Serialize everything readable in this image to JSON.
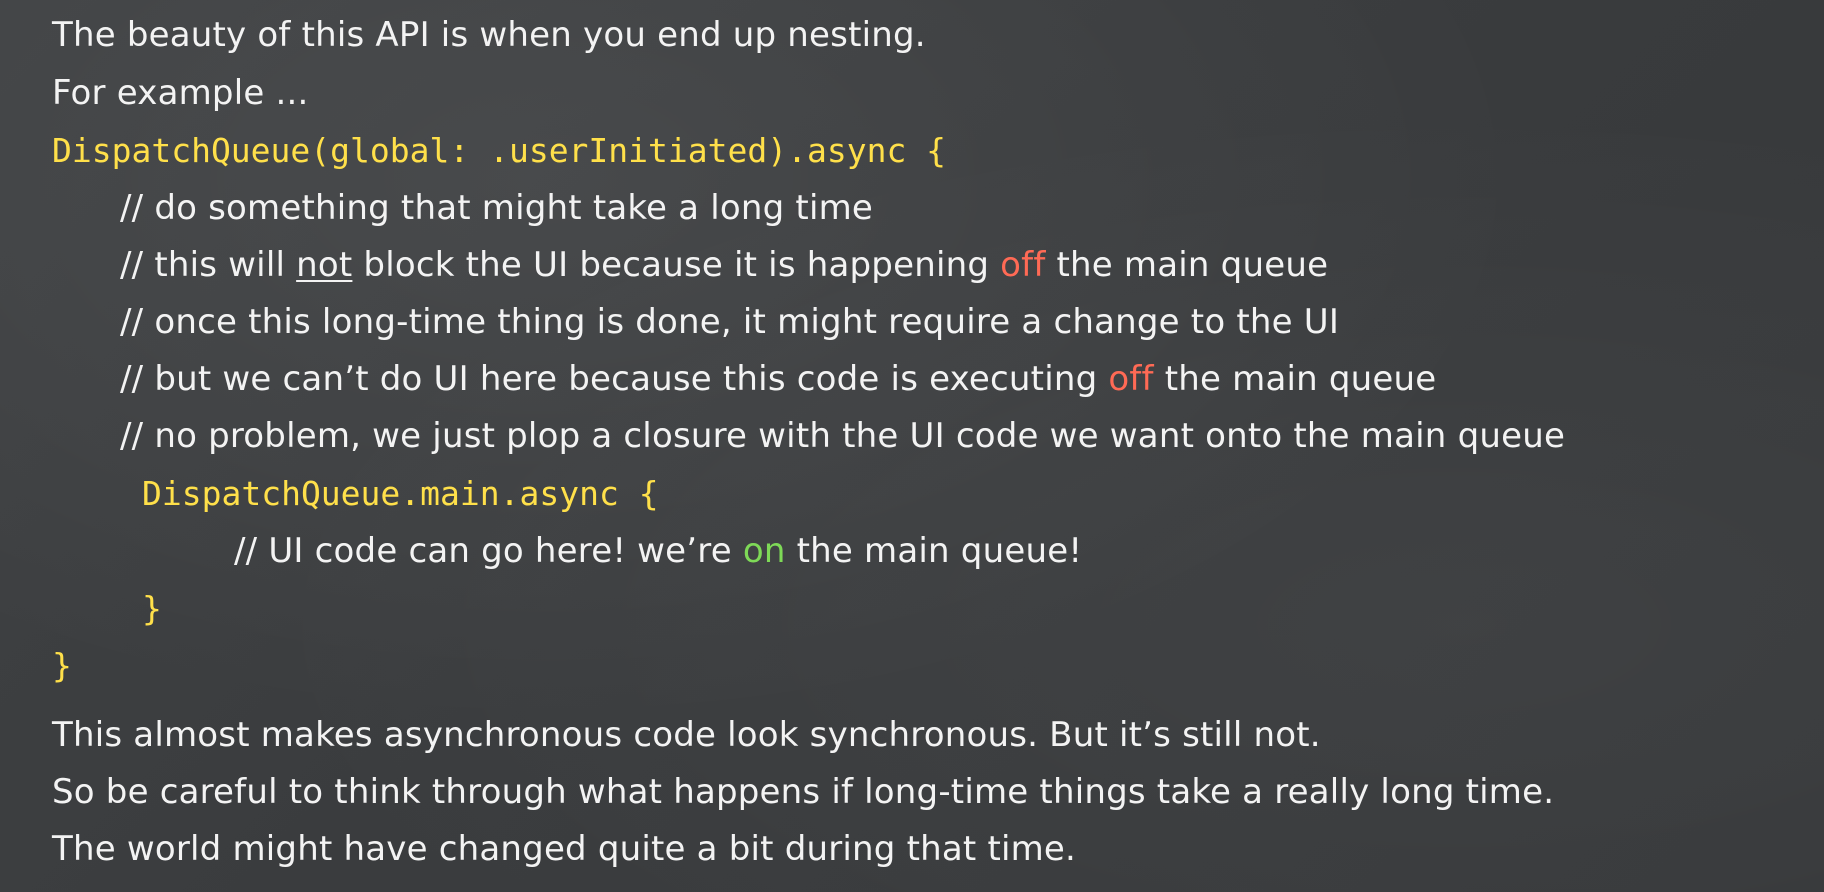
{
  "intro": {
    "line1": "The beauty of this API is when you end up nesting.",
    "line2": "For example ..."
  },
  "code": {
    "open_outer": "DispatchQueue(global: .userInitiated).async {",
    "comments": [
      "// do something that might take a long time",
      {
        "pre": "// this will ",
        "underlined": "not",
        "mid": " block the UI because it is happening ",
        "highlight": "off",
        "post": " the main queue"
      },
      "// once this long-time thing is done, it might require a change to the UI",
      {
        "pre": "// but we can’t do UI here because this code is executing ",
        "highlight": "off",
        "post": " the main queue"
      },
      "// no problem, we just plop a closure with the UI code we want onto the main queue"
    ],
    "open_inner": "DispatchQueue.main.async {",
    "inner_comment": {
      "pre": "// UI code can go here! we’re ",
      "highlight": "on",
      "post": " the main queue!"
    },
    "close_inner": "}",
    "close_outer": "}"
  },
  "outro": {
    "line1": "This almost makes asynchronous code look synchronous.  But it’s still not.",
    "line2": "So be careful to think through what happens if long-time things take a really long time.",
    "line3": "The world might have changed quite a bit during that time."
  },
  "colors": {
    "background": "#3c3e40",
    "text": "#f3f3f3",
    "code": "#ffe04a",
    "off": "#ff6a55",
    "on": "#7ed957"
  }
}
